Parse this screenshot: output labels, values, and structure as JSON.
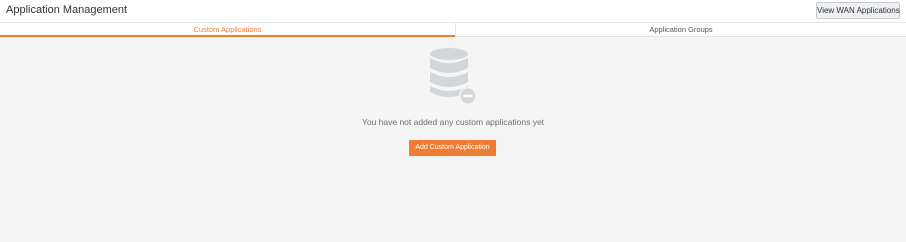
{
  "header": {
    "title": "Application Management",
    "view_wan_label": "View WAN Applications"
  },
  "tabs": [
    {
      "label": "Custom Applications",
      "active": true
    },
    {
      "label": "Application Groups",
      "active": false
    }
  ],
  "empty_state": {
    "icon": "database-minus-icon",
    "message": "You have not added any custom applications yet",
    "add_button_label": "Add Custom Application"
  },
  "colors": {
    "accent": "#f07c34",
    "icon_gray": "#d3d6db"
  }
}
